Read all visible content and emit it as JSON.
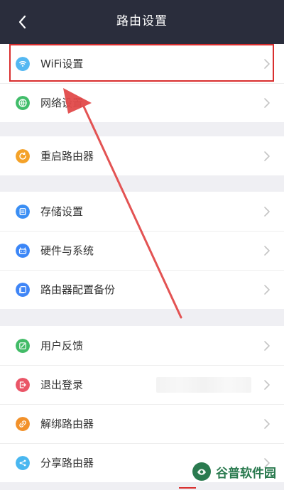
{
  "header": {
    "title": "路由设置",
    "back_icon": "chevron-left-icon"
  },
  "groups": [
    {
      "items": [
        {
          "label": "WiFi设置",
          "icon": "wifi-icon",
          "color": "#54b8f2"
        },
        {
          "label": "网络设置",
          "icon": "globe-icon",
          "color": "#41bd6a"
        }
      ]
    },
    {
      "items": [
        {
          "label": "重启路由器",
          "icon": "restart-icon",
          "color": "#f4a229"
        }
      ]
    },
    {
      "items": [
        {
          "label": "存储设置",
          "icon": "storage-icon",
          "color": "#3a8ef4"
        },
        {
          "label": "硬件与系统",
          "icon": "hardware-icon",
          "color": "#3b86f7"
        },
        {
          "label": "路由器配置备份",
          "icon": "backup-icon",
          "color": "#3f85f6"
        }
      ]
    },
    {
      "items": [
        {
          "label": "用户反馈",
          "icon": "feedback-icon",
          "color": "#42bb67"
        },
        {
          "label": "退出登录",
          "icon": "logout-icon",
          "color": "#ea5567"
        },
        {
          "label": "解绑路由器",
          "icon": "unlink-icon",
          "color": "#f2912a"
        },
        {
          "label": "分享路由器",
          "icon": "share-icon",
          "color": "#49b7f0"
        }
      ]
    }
  ],
  "annotation": {
    "highlight_color": "#d92e2e",
    "arrow_color": "#e24a4a"
  },
  "watermark": {
    "text": "谷普软件园",
    "color": "#2a7a4f"
  }
}
